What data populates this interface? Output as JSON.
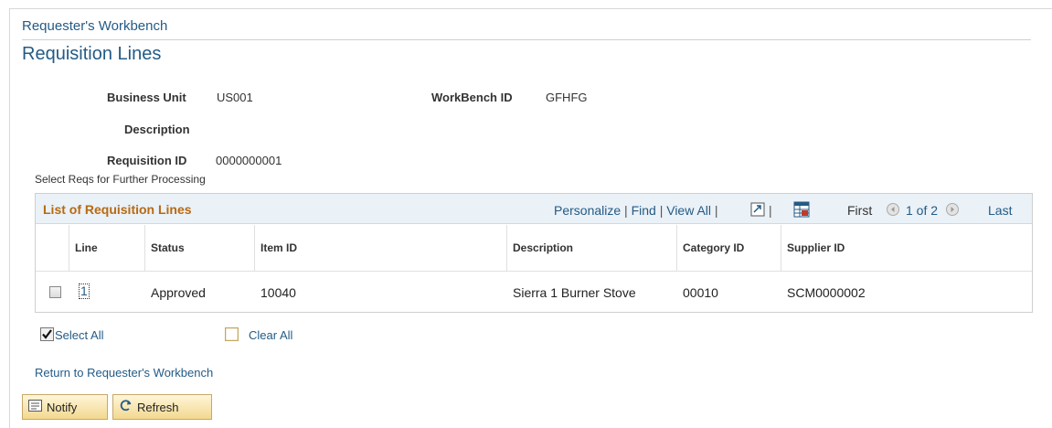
{
  "breadcrumb": "Requester's Workbench",
  "page_title": "Requisition Lines",
  "fields": {
    "business_unit_label": "Business Unit",
    "business_unit_value": "US001",
    "workbench_id_label": "WorkBench ID",
    "workbench_id_value": "GFHFG",
    "description_label": "Description",
    "description_value": "",
    "requisition_id_label": "Requisition ID",
    "requisition_id_value": "0000000001"
  },
  "section_label": "Select Reqs for Further Processing",
  "grid": {
    "title": "List of Requisition Lines",
    "personalize": "Personalize",
    "find": "Find",
    "view_all": "View All",
    "first": "First",
    "page_count": "1 of 2",
    "last": "Last",
    "columns": [
      "Line",
      "Status",
      "Item ID",
      "Description",
      "Category ID",
      "Supplier ID"
    ],
    "rows": [
      {
        "checked": false,
        "line": "1",
        "status": "Approved",
        "item_id": "10040",
        "description": "Sierra 1 Burner Stove",
        "category_id": "00010",
        "supplier_id": "SCM0000002"
      }
    ]
  },
  "select_all": "Select All",
  "clear_all": "Clear All",
  "return_link": "Return to Requester's Workbench",
  "buttons": {
    "notify": "Notify",
    "refresh": "Refresh"
  },
  "colors": {
    "link": "#245b86",
    "grid_title": "#b76a12",
    "grid_header_bg": "#eaf1f7",
    "button_bg": "#f2d88f"
  },
  "icons": [
    "download-to-spreadsheet-icon",
    "excel-icon",
    "prev-arrow-icon",
    "next-arrow-icon",
    "checkbox-icon",
    "notify-icon",
    "refresh-icon"
  ]
}
